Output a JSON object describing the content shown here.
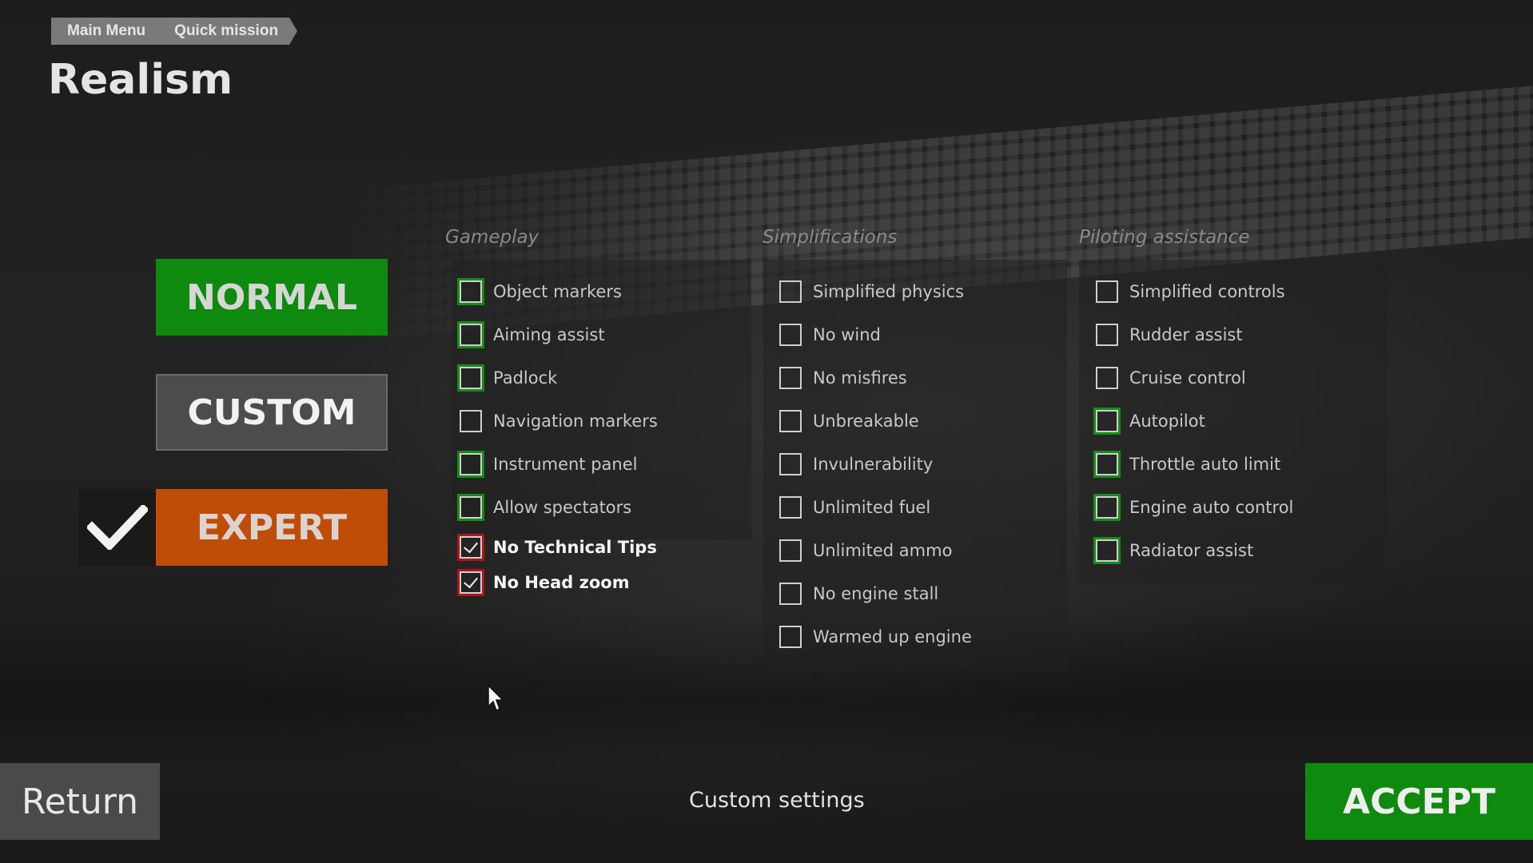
{
  "breadcrumb": [
    "Main Menu",
    "Quick mission"
  ],
  "page_title": "Realism",
  "presets": {
    "normal": "NORMAL",
    "custom": "CUSTOM",
    "expert": "EXPERT",
    "selected": "expert"
  },
  "columns": {
    "gameplay": {
      "title": "Gameplay",
      "options": [
        {
          "label": "Object markers",
          "checked": false,
          "outline": "green"
        },
        {
          "label": "Aiming assist",
          "checked": false,
          "outline": "green"
        },
        {
          "label": "Padlock",
          "checked": false,
          "outline": "green"
        },
        {
          "label": "Navigation markers",
          "checked": false,
          "outline": "none"
        },
        {
          "label": "Instrument panel",
          "checked": false,
          "outline": "green"
        },
        {
          "label": "Allow spectators",
          "checked": false,
          "outline": "green"
        },
        {
          "label": "No Technical Tips",
          "checked": true,
          "outline": "red"
        },
        {
          "label": "No Head zoom",
          "checked": true,
          "outline": "red"
        }
      ]
    },
    "simplifications": {
      "title": "Simplifications",
      "options": [
        {
          "label": "Simplified physics",
          "checked": false,
          "outline": "none"
        },
        {
          "label": "No wind",
          "checked": false,
          "outline": "none"
        },
        {
          "label": "No misfires",
          "checked": false,
          "outline": "none"
        },
        {
          "label": "Unbreakable",
          "checked": false,
          "outline": "none"
        },
        {
          "label": "Invulnerability",
          "checked": false,
          "outline": "none"
        },
        {
          "label": "Unlimited fuel",
          "checked": false,
          "outline": "none"
        },
        {
          "label": "Unlimited ammo",
          "checked": false,
          "outline": "none"
        },
        {
          "label": "No engine stall",
          "checked": false,
          "outline": "none"
        },
        {
          "label": "Warmed up engine",
          "checked": false,
          "outline": "none"
        }
      ]
    },
    "piloting": {
      "title": "Piloting assistance",
      "options": [
        {
          "label": "Simplified controls",
          "checked": false,
          "outline": "none"
        },
        {
          "label": "Rudder assist",
          "checked": false,
          "outline": "none"
        },
        {
          "label": "Cruise control",
          "checked": false,
          "outline": "none"
        },
        {
          "label": "Autopilot",
          "checked": false,
          "outline": "green"
        },
        {
          "label": "Throttle auto limit",
          "checked": false,
          "outline": "green"
        },
        {
          "label": "Engine auto control",
          "checked": false,
          "outline": "green"
        },
        {
          "label": "Radiator assist",
          "checked": false,
          "outline": "green"
        }
      ]
    }
  },
  "footer": {
    "return_label": "Return",
    "status": "Custom settings",
    "accept_label": "ACCEPT"
  },
  "colors": {
    "normal": "#0e8a0e",
    "custom": "#4c4c4c",
    "expert": "#bf4d08",
    "accept": "#0e8a0e",
    "green_outline": "#168c16",
    "red_outline": "#b0151a"
  },
  "icons": {
    "selected_check": "checkmark-icon",
    "cursor": "mouse-cursor-icon"
  }
}
